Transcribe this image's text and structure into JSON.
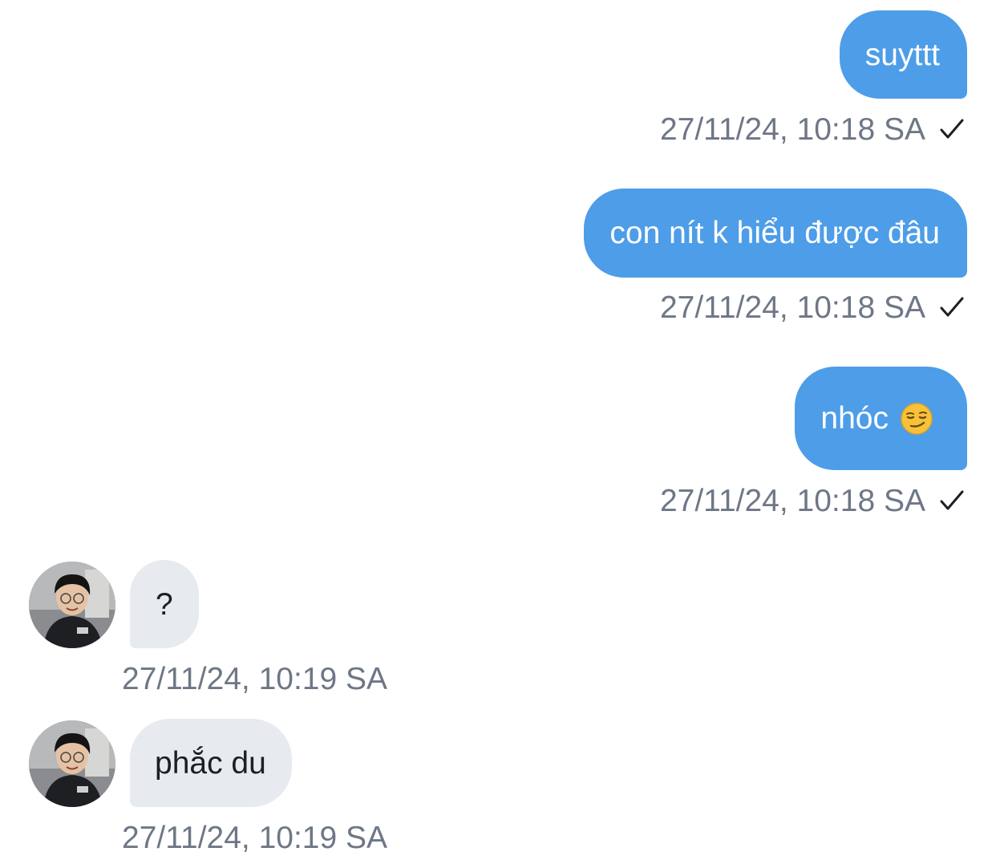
{
  "messages": [
    {
      "direction": "sent",
      "text": "suyttt",
      "timestamp": "27/11/24, 10:18 SA",
      "status_icon": "check-icon"
    },
    {
      "direction": "sent",
      "text": "con nít k hiểu được đâu",
      "timestamp": "27/11/24, 10:18 SA",
      "status_icon": "check-icon"
    },
    {
      "direction": "sent",
      "text": "nhóc",
      "emoji": "smirking-face-icon",
      "timestamp": "27/11/24, 10:18 SA",
      "status_icon": "check-icon"
    },
    {
      "direction": "received",
      "text": "?",
      "timestamp": "27/11/24, 10:19 SA",
      "avatar": "contact-avatar"
    },
    {
      "direction": "received",
      "text": "phắc du",
      "timestamp": "27/11/24, 10:19 SA",
      "avatar": "contact-avatar"
    }
  ],
  "colors": {
    "sent_bubble": "#4d9de8",
    "received_bubble": "#e7eaee",
    "timestamp_text": "#6e7786",
    "background": "#ffffff"
  }
}
